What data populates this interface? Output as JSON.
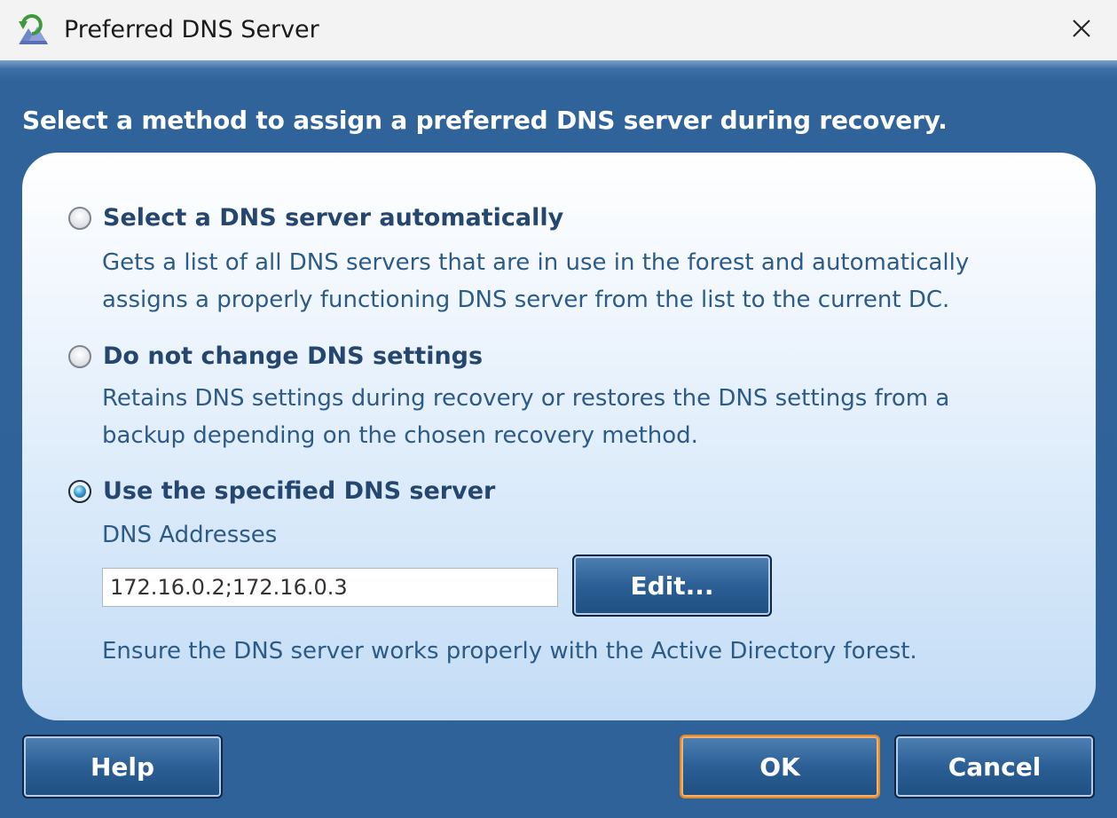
{
  "window": {
    "title": "Preferred DNS Server",
    "app_icon": "recovery-app-icon",
    "close_icon": "close-icon"
  },
  "instruction": "Select a method to assign a preferred DNS server during recovery.",
  "options": [
    {
      "label": "Select a DNS server automatically",
      "desc_line1": "Gets a list of all DNS servers that are in use in the forest and automatically",
      "desc_line2": "assigns a properly functioning DNS server from the list to the current DC.",
      "selected": false
    },
    {
      "label": "Do not change DNS settings",
      "desc_line1": "Retains DNS settings during recovery or restores the DNS settings from a",
      "desc_line2": "backup depending on the chosen recovery method.",
      "selected": false
    },
    {
      "label": "Use the specified DNS server",
      "selected": true
    }
  ],
  "dns": {
    "field_label": "DNS Addresses",
    "value": "172.16.0.2;172.16.0.3",
    "edit_label": "Edit...",
    "note": "Ensure the DNS server works properly with the Active Directory forest."
  },
  "buttons": {
    "help": "Help",
    "ok": "OK",
    "cancel": "Cancel"
  },
  "colors": {
    "background": "#2e6399",
    "panel_text": "#2d5b88",
    "option_label": "#24466f",
    "ok_focus_border": "#e08a2e"
  }
}
